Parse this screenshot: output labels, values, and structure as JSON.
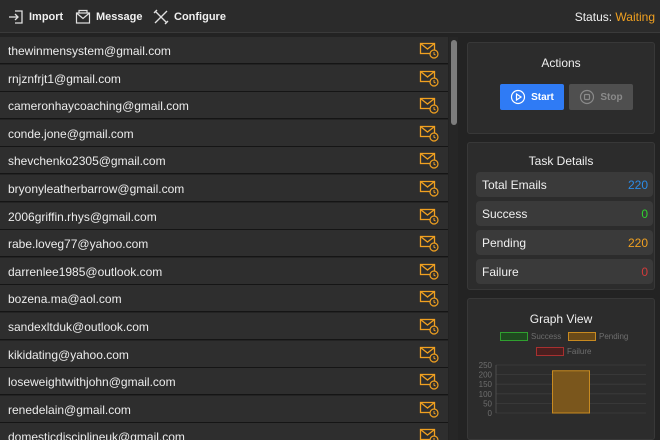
{
  "toolbar": {
    "import_label": "Import",
    "message_label": "Message",
    "configure_label": "Configure",
    "status_label": "Status:",
    "status_value": "Waiting"
  },
  "emails": [
    "thewinmensystem@gmail.com",
    "rnjznfrjt1@gmail.com",
    "cameronhaycoaching@gmail.com",
    "conde.jone@gmail.com",
    "shevchenko2305@gmail.com",
    "bryonyleatherbarrow@gmail.com",
    "2006griffin.rhys@gmail.com",
    "rabe.loveg77@yahoo.com",
    "darrenlee1985@outlook.com",
    "bozena.ma@aol.com",
    "sandexltduk@outlook.com",
    "kikidating@yahoo.com",
    "loseweightwithjohn@gmail.com",
    "renedelain@gmail.com",
    "domesticdisciplineuk@gmail.com"
  ],
  "actions": {
    "title": "Actions",
    "start_label": "Start",
    "stop_label": "Stop"
  },
  "task_details": {
    "title": "Task Details",
    "total_label": "Total Emails",
    "total_value": "220",
    "success_label": "Success",
    "success_value": "0",
    "pending_label": "Pending",
    "pending_value": "220",
    "failure_label": "Failure",
    "failure_value": "0"
  },
  "colors": {
    "accent_orange": "#f0a020",
    "start_blue": "#2f7bf5",
    "total_blue": "#2b8ce8",
    "success_green": "#2fd22f",
    "failure_red": "#d23a3a"
  },
  "graph": {
    "title": "Graph View",
    "chart_data": {
      "type": "bar",
      "categories": [
        "Success",
        "Pending",
        "Failure"
      ],
      "series": [
        {
          "name": "Success",
          "values": [
            0
          ]
        },
        {
          "name": "Pending",
          "values": [
            220
          ]
        },
        {
          "name": "Failure",
          "values": [
            0
          ]
        }
      ],
      "yticks": [
        "250",
        "200",
        "150",
        "100",
        "50",
        "0"
      ],
      "ylim": [
        0,
        250
      ]
    }
  }
}
